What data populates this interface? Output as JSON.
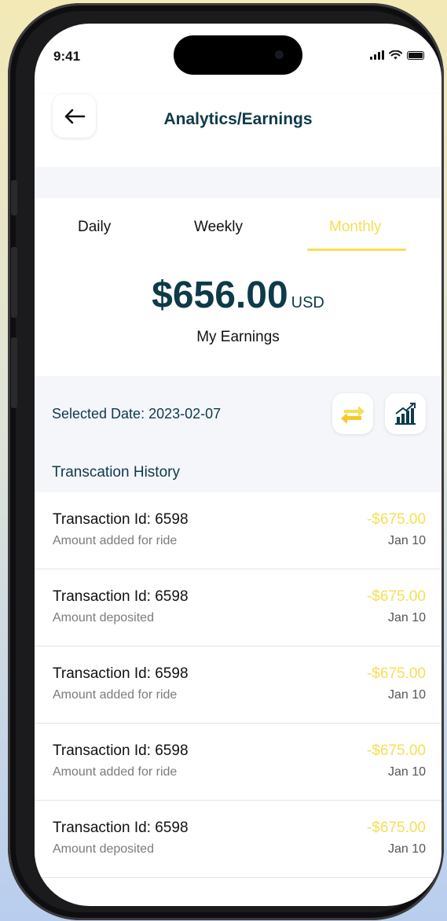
{
  "status_bar": {
    "time": "9:41"
  },
  "header": {
    "title": "Analytics/Earnings",
    "back_icon": "arrow-left-icon"
  },
  "tabs": [
    {
      "label": "Daily",
      "active": false
    },
    {
      "label": "Weekly",
      "active": false
    },
    {
      "label": "Monthly",
      "active": true
    }
  ],
  "earnings": {
    "amount": "$656.00",
    "currency": "USD",
    "label": "My Earnings"
  },
  "selected_date": "Selected Date: 2023-02-07",
  "history_title": "Transcation History",
  "colors": {
    "accent": "#f6de55",
    "primary_text": "#0e3a4a"
  },
  "transactions": [
    {
      "id": "Transaction Id: 6598",
      "desc": "Amount added for ride",
      "amount": "-$675.00",
      "date": "Jan 10"
    },
    {
      "id": "Transaction Id: 6598",
      "desc": "Amount deposited",
      "amount": "-$675.00",
      "date": "Jan 10"
    },
    {
      "id": "Transaction Id: 6598",
      "desc": "Amount added for ride",
      "amount": "-$675.00",
      "date": "Jan 10"
    },
    {
      "id": "Transaction Id: 6598",
      "desc": "Amount added for ride",
      "amount": "-$675.00",
      "date": "Jan 10"
    },
    {
      "id": "Transaction Id: 6598",
      "desc": "Amount deposited",
      "amount": "-$675.00",
      "date": "Jan 10"
    }
  ]
}
